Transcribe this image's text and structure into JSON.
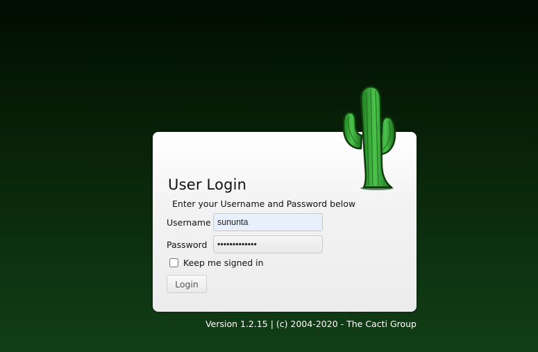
{
  "login": {
    "title": "User Login",
    "subtitle": "Enter your Username and Password below",
    "username_label": "Username",
    "username_value": "sununta",
    "password_label": "Password",
    "password_value": "•••••••••••••",
    "remember_label": "Keep me signed in",
    "remember_checked": false,
    "login_button": "Login"
  },
  "footer": {
    "version_text": "Version 1.2.15 | (c) 2004-2020 - The Cacti Group"
  },
  "logo": {
    "icon": "cactus-icon"
  },
  "colors": {
    "background_top": "#010d01",
    "background_bottom": "#113f16",
    "cactus_green": "#2e9e2e",
    "cactus_outline": "#0d3b0d"
  }
}
